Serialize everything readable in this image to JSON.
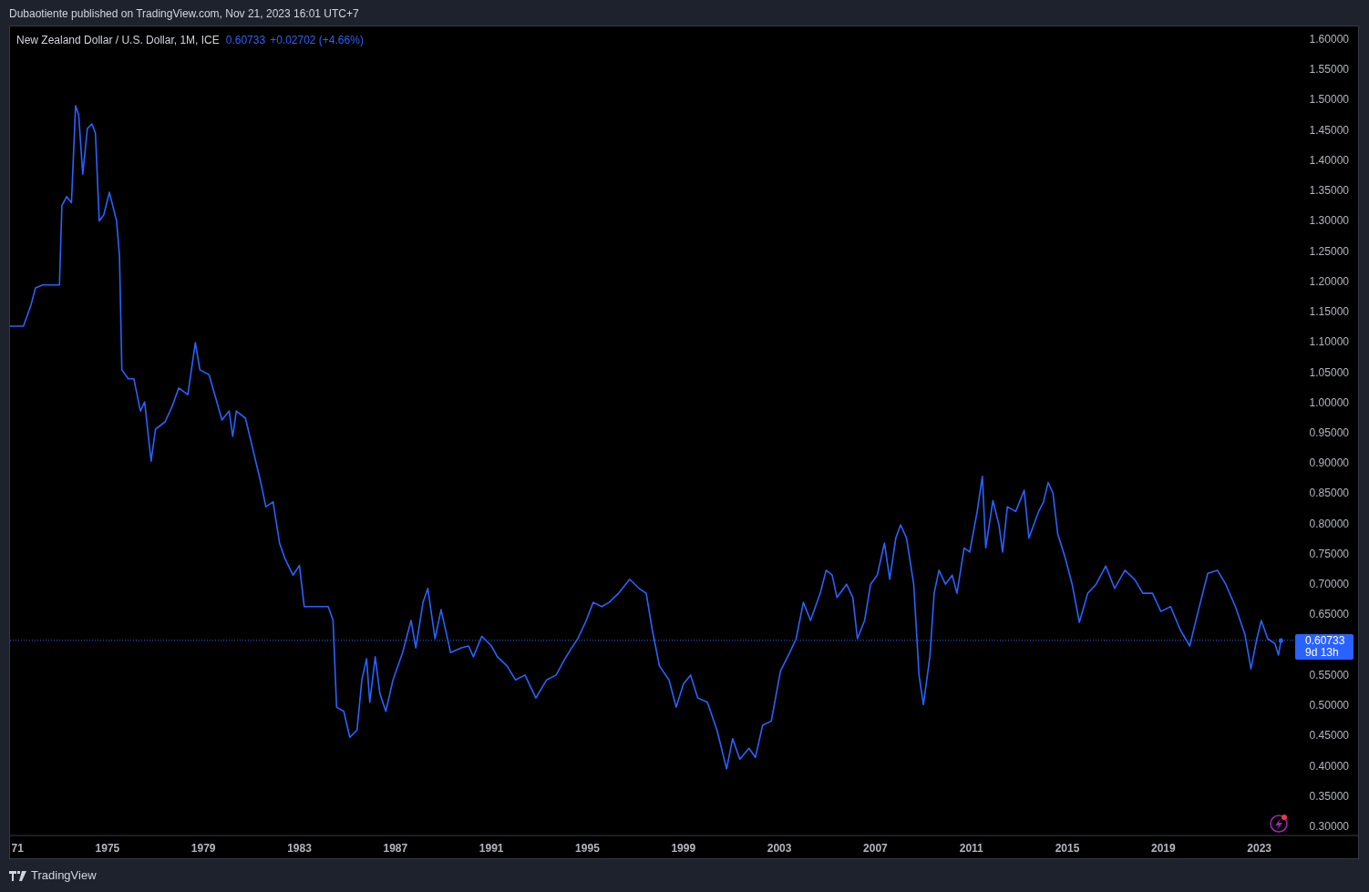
{
  "header": {
    "publisher_line": "Dubaotiente published on TradingView.com, Nov 21, 2023 16:01 UTC+7"
  },
  "legend": {
    "symbol": "New Zealand Dollar / U.S. Dollar, 1M, ICE",
    "price": "0.60733",
    "change": "+0.02702 (+4.66%)"
  },
  "price_label": {
    "countdown": "9d 13h"
  },
  "chart": {
    "chart_data": {
      "type": "line",
      "xlim": [
        1970.94,
        2027.19
      ],
      "ylim": [
        0.285,
        1.621
      ],
      "xticks": [
        {
          "value": 1971,
          "label": "71"
        },
        1975,
        1979,
        1983,
        1987,
        1991,
        1995,
        1999,
        2003,
        2007,
        2011,
        2015,
        2019,
        2023
      ],
      "yticks": [
        {
          "value": 0.3,
          "label": "0.30000"
        },
        {
          "value": 0.35,
          "label": "0.35000"
        },
        {
          "value": 0.4,
          "label": "0.40000"
        },
        {
          "value": 0.45,
          "label": "0.45000"
        },
        {
          "value": 0.5,
          "label": "0.50000"
        },
        {
          "value": 0.55,
          "label": "0.55000"
        },
        {
          "value": 0.65,
          "label": "0.65000"
        },
        {
          "value": 0.7,
          "label": "0.70000"
        },
        {
          "value": 0.75,
          "label": "0.75000"
        },
        {
          "value": 0.8,
          "label": "0.80000"
        },
        {
          "value": 0.85,
          "label": "0.85000"
        },
        {
          "value": 0.9,
          "label": "0.90000"
        },
        {
          "value": 0.95,
          "label": "0.95000"
        },
        {
          "value": 1.0,
          "label": "1.00000"
        },
        {
          "value": 1.05,
          "label": "1.05000"
        },
        {
          "value": 1.1,
          "label": "1.10000"
        },
        {
          "value": 1.15,
          "label": "1.15000"
        },
        {
          "value": 1.2,
          "label": "1.20000"
        },
        {
          "value": 1.25,
          "label": "1.25000"
        },
        {
          "value": 1.3,
          "label": "1.30000"
        },
        {
          "value": 1.35,
          "label": "1.35000"
        },
        {
          "value": 1.4,
          "label": "1.40000"
        },
        {
          "value": 1.45,
          "label": "1.45000"
        },
        {
          "value": 1.5,
          "label": "1.50000"
        },
        {
          "value": 1.55,
          "label": "1.55000"
        },
        {
          "value": 1.6,
          "label": "1.60000"
        }
      ],
      "x": [
        1970.94,
        1971.5,
        1971.8,
        1972.0,
        1972.3,
        1973.0,
        1973.1,
        1973.3,
        1973.5,
        1973.67,
        1973.8,
        1973.97,
        1974.16,
        1974.35,
        1974.5,
        1974.66,
        1974.85,
        1975.08,
        1975.38,
        1975.5,
        1975.6,
        1975.87,
        1976.1,
        1976.37,
        1976.55,
        1976.82,
        1977.0,
        1977.4,
        1977.7,
        1977.97,
        1978.35,
        1978.66,
        1978.85,
        1979.23,
        1979.5,
        1979.77,
        1980.07,
        1980.22,
        1980.37,
        1980.75,
        1981.13,
        1981.4,
        1981.6,
        1981.9,
        1982.17,
        1982.4,
        1982.73,
        1983.0,
        1983.2,
        1983.7,
        1984.2,
        1984.4,
        1984.55,
        1984.85,
        1985.1,
        1985.4,
        1985.6,
        1985.8,
        1985.93,
        1986.16,
        1986.35,
        1986.6,
        1986.9,
        1987.3,
        1987.65,
        1987.85,
        1988.15,
        1988.35,
        1988.65,
        1988.9,
        1989.3,
        1989.75,
        1990.05,
        1990.25,
        1990.6,
        1991.0,
        1991.25,
        1991.65,
        1992.0,
        1992.4,
        1992.85,
        1993.3,
        1993.7,
        1994.0,
        1994.3,
        1994.6,
        1994.95,
        1995.24,
        1995.6,
        1995.9,
        1996.3,
        1996.76,
        1997.15,
        1997.45,
        1997.7,
        1998.0,
        1998.4,
        1998.7,
        1999.0,
        1999.3,
        1999.6,
        2000.0,
        2000.4,
        2000.8,
        2001.05,
        2001.35,
        2001.73,
        2002.0,
        2002.3,
        2002.66,
        2003.05,
        2003.43,
        2003.7,
        2004.0,
        2004.3,
        2004.7,
        2004.95,
        2005.2,
        2005.4,
        2005.8,
        2006.06,
        2006.25,
        2006.55,
        2006.8,
        2007.08,
        2007.38,
        2007.6,
        2007.85,
        2008.05,
        2008.3,
        2008.6,
        2008.82,
        2009.0,
        2009.27,
        2009.45,
        2009.65,
        2009.92,
        2010.2,
        2010.4,
        2010.7,
        2010.93,
        2011.24,
        2011.46,
        2011.6,
        2011.9,
        2012.15,
        2012.3,
        2012.5,
        2012.85,
        2013.2,
        2013.4,
        2013.8,
        2014.0,
        2014.2,
        2014.4,
        2014.6,
        2014.9,
        2015.2,
        2015.5,
        2015.85,
        2016.2,
        2016.6,
        2016.97,
        2017.4,
        2017.8,
        2018.15,
        2018.55,
        2018.9,
        2019.3,
        2019.7,
        2020.1,
        2020.45,
        2020.85,
        2021.25,
        2021.6,
        2022.0,
        2022.4,
        2022.65,
        2022.9,
        2023.08,
        2023.35,
        2023.65,
        2023.8,
        2023.9
      ],
      "ref_lines": [
        {
          "axis": "y",
          "value": 0.60733,
          "label": "0.60733"
        }
      ],
      "series": [
        {
          "color": "#2962ff",
          "values": [
            1.126,
            1.126,
            1.159,
            1.189,
            1.194,
            1.194,
            1.325,
            1.34,
            1.33,
            1.49,
            1.475,
            1.377,
            1.452,
            1.46,
            1.445,
            1.3,
            1.31,
            1.347,
            1.3,
            1.242,
            1.054,
            1.039,
            1.039,
            0.986,
            1.001,
            0.903,
            0.956,
            0.968,
            0.994,
            1.024,
            1.013,
            1.099,
            1.054,
            1.046,
            1.009,
            0.971,
            0.986,
            0.944,
            0.986,
            0.974,
            0.911,
            0.866,
            0.828,
            0.836,
            0.768,
            0.742,
            0.715,
            0.731,
            0.663,
            0.663,
            0.663,
            0.64,
            0.497,
            0.49,
            0.447,
            0.459,
            0.542,
            0.577,
            0.505,
            0.58,
            0.52,
            0.49,
            0.542,
            0.587,
            0.64,
            0.595,
            0.67,
            0.693,
            0.61,
            0.658,
            0.587,
            0.595,
            0.598,
            0.58,
            0.614,
            0.598,
            0.58,
            0.565,
            0.542,
            0.55,
            0.512,
            0.542,
            0.55,
            0.572,
            0.592,
            0.61,
            0.64,
            0.67,
            0.663,
            0.67,
            0.685,
            0.708,
            0.693,
            0.685,
            0.625,
            0.565,
            0.542,
            0.497,
            0.535,
            0.55,
            0.512,
            0.505,
            0.459,
            0.395,
            0.445,
            0.411,
            0.429,
            0.414,
            0.467,
            0.474,
            0.557,
            0.587,
            0.61,
            0.67,
            0.64,
            0.685,
            0.723,
            0.715,
            0.678,
            0.7,
            0.678,
            0.61,
            0.64,
            0.7,
            0.715,
            0.768,
            0.708,
            0.776,
            0.798,
            0.776,
            0.7,
            0.55,
            0.501,
            0.58,
            0.685,
            0.723,
            0.7,
            0.715,
            0.685,
            0.76,
            0.753,
            0.82,
            0.878,
            0.76,
            0.838,
            0.798,
            0.753,
            0.828,
            0.82,
            0.855,
            0.776,
            0.82,
            0.835,
            0.868,
            0.85,
            0.783,
            0.745,
            0.7,
            0.637,
            0.685,
            0.7,
            0.73,
            0.693,
            0.723,
            0.708,
            0.685,
            0.685,
            0.655,
            0.663,
            0.625,
            0.598,
            0.655,
            0.718,
            0.723,
            0.7,
            0.663,
            0.617,
            0.56,
            0.61,
            0.64,
            0.61,
            0.602,
            0.583,
            0.607
          ]
        }
      ]
    }
  },
  "footer": {
    "brand": "TradingView"
  }
}
